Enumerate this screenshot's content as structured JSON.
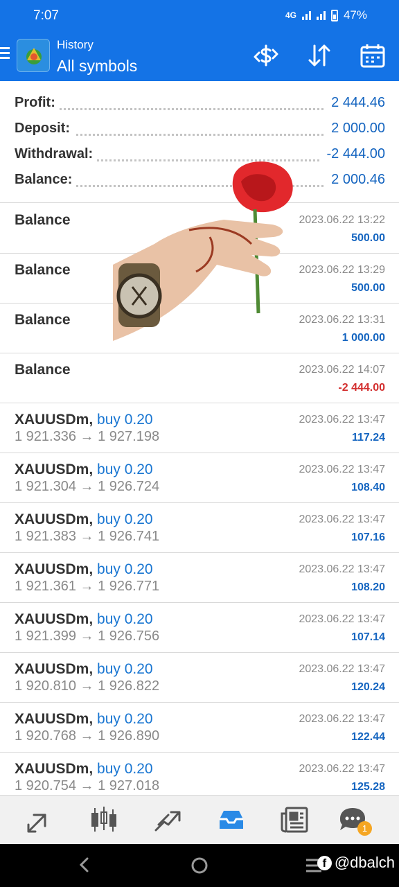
{
  "status": {
    "time": "7:07",
    "network": "4G",
    "battery": "47%"
  },
  "header": {
    "title": "History",
    "subtitle": "All symbols"
  },
  "summary": [
    {
      "label": "Profit:",
      "value": "2 444.46"
    },
    {
      "label": "Deposit:",
      "value": "2 000.00"
    },
    {
      "label": "Withdrawal:",
      "value": "-2 444.00"
    },
    {
      "label": "Balance:",
      "value": "2 000.46"
    }
  ],
  "deals": [
    {
      "title": "Balance",
      "direction": "",
      "prices": "",
      "date": "2023.06.22 13:22",
      "amount": "500.00"
    },
    {
      "title": "Balance",
      "direction": "",
      "prices": "",
      "date": "2023.06.22 13:29",
      "amount": "500.00"
    },
    {
      "title": "Balance",
      "direction": "",
      "prices": "",
      "date": "2023.06.22 13:31",
      "amount": "1 000.00"
    },
    {
      "title": "Balance",
      "direction": "",
      "prices": "",
      "date": "2023.06.22 14:07",
      "amount": "-2 444.00"
    },
    {
      "title": "XAUUSDm,",
      "direction": "buy 0.20",
      "prices": "1 921.336 → 1 927.198",
      "date": "2023.06.22 13:47",
      "amount": "117.24"
    },
    {
      "title": "XAUUSDm,",
      "direction": "buy 0.20",
      "prices": "1 921.304 → 1 926.724",
      "date": "2023.06.22 13:47",
      "amount": "108.40"
    },
    {
      "title": "XAUUSDm,",
      "direction": "buy 0.20",
      "prices": "1 921.383 → 1 926.741",
      "date": "2023.06.22 13:47",
      "amount": "107.16"
    },
    {
      "title": "XAUUSDm,",
      "direction": "buy 0.20",
      "prices": "1 921.361 → 1 926.771",
      "date": "2023.06.22 13:47",
      "amount": "108.20"
    },
    {
      "title": "XAUUSDm,",
      "direction": "buy 0.20",
      "prices": "1 921.399 → 1 926.756",
      "date": "2023.06.22 13:47",
      "amount": "107.14"
    },
    {
      "title": "XAUUSDm,",
      "direction": "buy 0.20",
      "prices": "1 920.810 → 1 926.822",
      "date": "2023.06.22 13:47",
      "amount": "120.24"
    },
    {
      "title": "XAUUSDm,",
      "direction": "buy 0.20",
      "prices": "1 920.768 → 1 926.890",
      "date": "2023.06.22 13:47",
      "amount": "122.44"
    },
    {
      "title": "XAUUSDm,",
      "direction": "buy 0.20",
      "prices": "1 920.754 → 1 927.018",
      "date": "2023.06.22 13:47",
      "amount": "125.28"
    }
  ],
  "bottom_nav": {
    "items": [
      "quotes-icon",
      "chart-icon",
      "trade-icon",
      "history-icon",
      "news-icon",
      "messages-icon"
    ],
    "messages_badge": "1"
  },
  "watermark": "@dbalch",
  "colors": {
    "primary": "#1473e6",
    "positive": "#1565c0",
    "negative": "#d32f2f",
    "buy": "#1976d2"
  }
}
